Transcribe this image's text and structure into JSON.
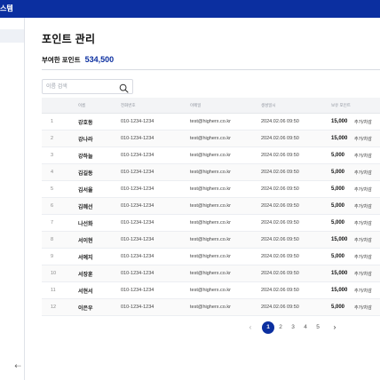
{
  "header": {
    "brand_fragment": "스템"
  },
  "sidebar": {
    "collapse_icon": "arrow-left-icon",
    "collapse_glyph": "⇠"
  },
  "page": {
    "title": "포인트 관리",
    "points_label": "부여한 포인트",
    "points_value": "534,500"
  },
  "search": {
    "placeholder": "이름 검색",
    "value": ""
  },
  "table": {
    "headers": {
      "no": "",
      "name": "이름",
      "phone": "전화번호",
      "email": "이메일",
      "date": "생성일시",
      "point": "보유 포인트",
      "action": ""
    },
    "rows": [
      {
        "no": "1",
        "name": "강호동",
        "phone": "010-1234-1234",
        "email": "test@higherx.co.kr",
        "date": "2024.02.06 09:50",
        "point": "15,000",
        "action": "추가/차감"
      },
      {
        "no": "2",
        "name": "강나라",
        "phone": "010-1234-1234",
        "email": "test@higherx.co.kr",
        "date": "2024.02.06 09:50",
        "point": "15,000",
        "action": "추가/차감"
      },
      {
        "no": "3",
        "name": "강하늘",
        "phone": "010-1234-1234",
        "email": "test@higherx.co.kr",
        "date": "2024.02.06 09:50",
        "point": "5,000",
        "action": "추가/차감"
      },
      {
        "no": "4",
        "name": "김길동",
        "phone": "010-1234-1234",
        "email": "test@higherx.co.kr",
        "date": "2024.02.06 09:50",
        "point": "5,000",
        "action": "추가/차감"
      },
      {
        "no": "5",
        "name": "김서율",
        "phone": "010-1234-1234",
        "email": "test@higherx.co.kr",
        "date": "2024.02.06 09:50",
        "point": "5,000",
        "action": "추가/차감"
      },
      {
        "no": "6",
        "name": "김혜선",
        "phone": "010-1234-1234",
        "email": "test@higherx.co.kr",
        "date": "2024.02.06 09:50",
        "point": "5,000",
        "action": "추가/차감"
      },
      {
        "no": "7",
        "name": "나선화",
        "phone": "010-1234-1234",
        "email": "test@higherx.co.kr",
        "date": "2024.02.06 09:50",
        "point": "5,000",
        "action": "추가/차감"
      },
      {
        "no": "8",
        "name": "서이현",
        "phone": "010-1234-1234",
        "email": "test@higherx.co.kr",
        "date": "2024.02.06 09:50",
        "point": "15,000",
        "action": "추가/차감"
      },
      {
        "no": "9",
        "name": "서예지",
        "phone": "010-1234-1234",
        "email": "test@higherx.co.kr",
        "date": "2024.02.06 09:50",
        "point": "5,000",
        "action": "추가/차감"
      },
      {
        "no": "10",
        "name": "서장훈",
        "phone": "010-1234-1234",
        "email": "test@higherx.co.kr",
        "date": "2024.02.06 09:50",
        "point": "15,000",
        "action": "추가/차감"
      },
      {
        "no": "11",
        "name": "서현서",
        "phone": "010-1234-1234",
        "email": "test@higherx.co.kr",
        "date": "2024.02.06 09:50",
        "point": "15,000",
        "action": "추가/차감"
      },
      {
        "no": "12",
        "name": "이은우",
        "phone": "010-1234-1234",
        "email": "test@higherx.co.kr",
        "date": "2024.02.06 09:50",
        "point": "5,000",
        "action": "추가/차감"
      }
    ]
  },
  "pagination": {
    "prev": "‹",
    "next": "›",
    "pages": [
      "1",
      "2",
      "3",
      "4",
      "5"
    ],
    "current": "1"
  },
  "colors": {
    "brand": "#0b2fa0",
    "header_bg": "#f3f4f6",
    "border": "#d8dbe2"
  }
}
